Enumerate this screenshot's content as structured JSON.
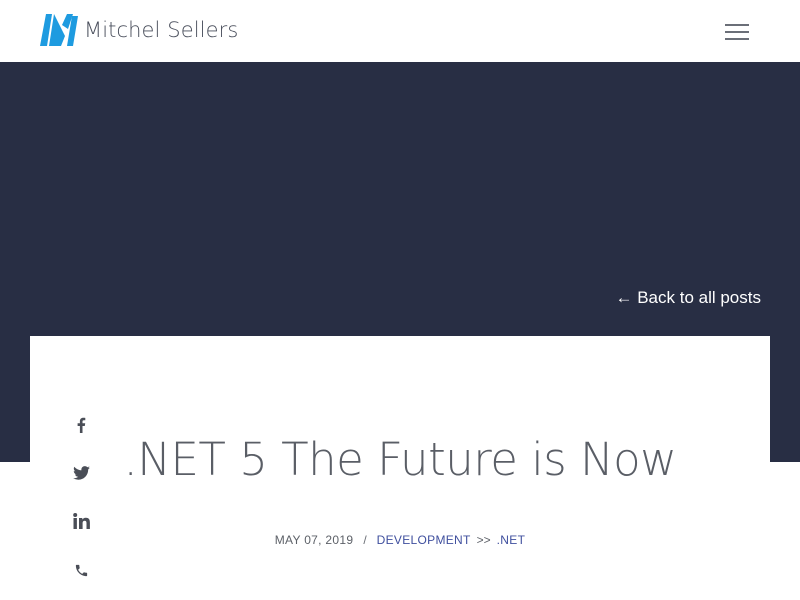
{
  "header": {
    "site_name": "Mitchel Sellers",
    "logo_icon": "ms-logo-icon",
    "logo_color": "#1e9be0",
    "menu_icon": "hamburger-menu-icon"
  },
  "hero": {
    "background_color": "#282e44",
    "back_link": "← Back to all posts"
  },
  "share": [
    {
      "icon": "facebook-icon"
    },
    {
      "icon": "twitter-icon"
    },
    {
      "icon": "linkedin-icon"
    },
    {
      "icon": "phone-icon"
    }
  ],
  "post": {
    "title": ".NET 5 The Future is Now",
    "date": "MAY 07, 2019",
    "separator": "/",
    "category": "DEVELOPMENT",
    "category_divider": ">>",
    "subcategory": ".NET"
  }
}
